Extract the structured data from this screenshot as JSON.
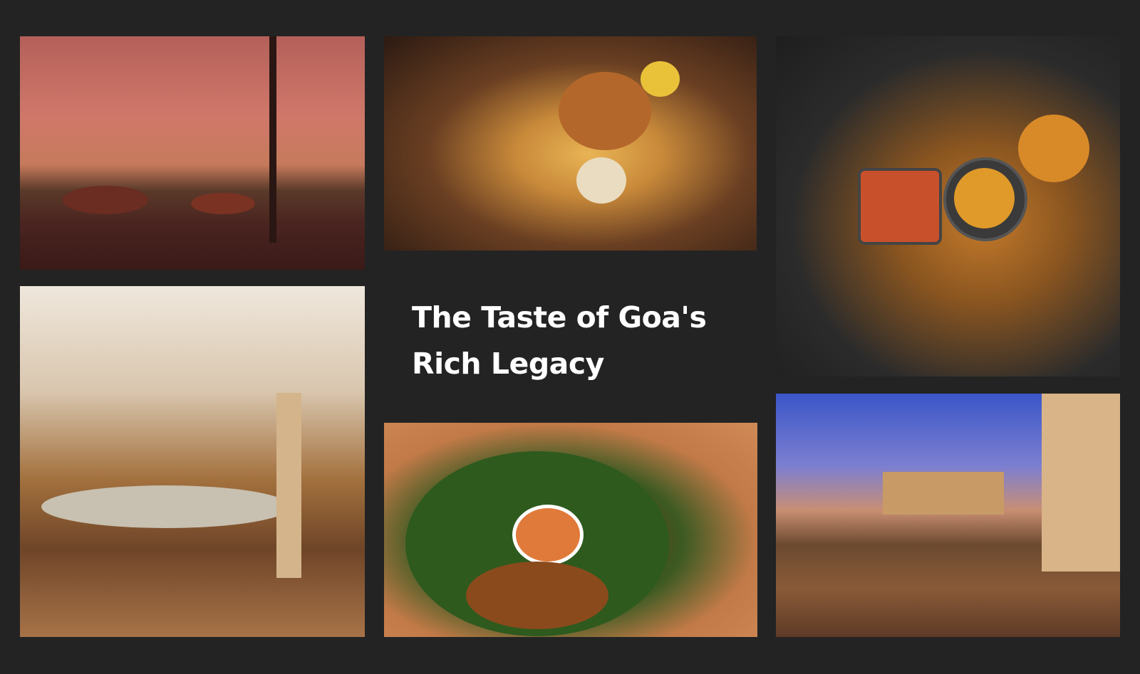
{
  "title": {
    "line1": "The Taste of Goa's",
    "line2": "Rich Legacy"
  },
  "photos": [
    {
      "name": "beach-restaurant-sunset-photo"
    },
    {
      "name": "burger-fries-photo"
    },
    {
      "name": "indian-thali-dishes-photo"
    },
    {
      "name": "restaurant-bar-interior-photo"
    },
    {
      "name": "fried-fish-platter-photo"
    },
    {
      "name": "outdoor-courtyard-dining-photo"
    }
  ],
  "colors": {
    "background": "#232323",
    "title_text": "#ffffff"
  }
}
